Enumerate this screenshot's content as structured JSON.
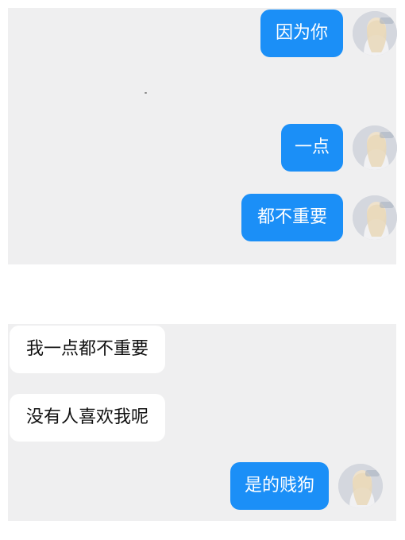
{
  "chat": {
    "messages": [
      {
        "text": "因为你",
        "side": "outgoing"
      },
      {
        "text": "一点",
        "side": "outgoing"
      },
      {
        "text": "都不重要",
        "side": "outgoing"
      },
      {
        "text": "我一点都不重要",
        "side": "incoming"
      },
      {
        "text": "没有人喜欢我呢",
        "side": "incoming"
      },
      {
        "text": "是的贱狗",
        "side": "outgoing"
      }
    ]
  },
  "colors": {
    "outgoing_bubble": "#1b8ff7",
    "incoming_bubble": "#ffffff",
    "panel_background": "#efeff0"
  }
}
